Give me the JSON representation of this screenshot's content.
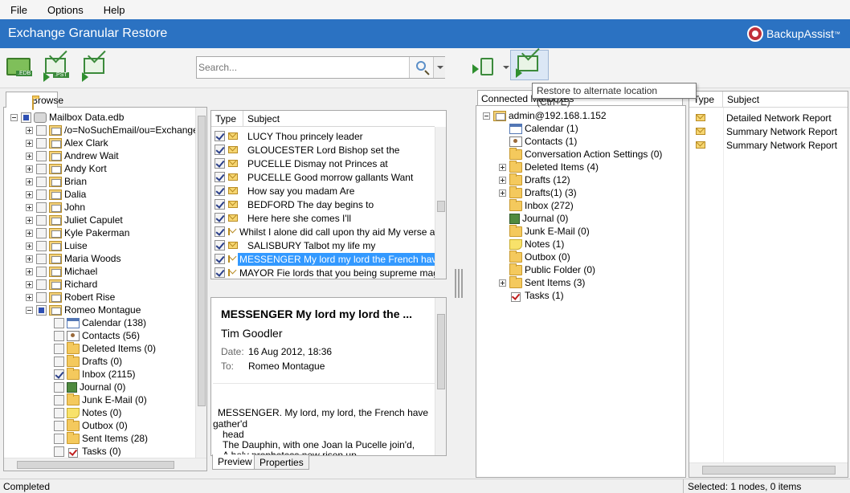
{
  "menu": {
    "file": "File",
    "options": "Options",
    "help": "Help"
  },
  "app_title": "Exchange Granular Restore",
  "brand": "BackupAssist",
  "brand_tm": "™",
  "toolbar": {
    "open_edb_tag": ".EDB",
    "export_pst_tag": ".PST",
    "search_placeholder": "Search...",
    "tooltip": "Restore to alternate location (Ctrl+E)"
  },
  "browse": {
    "tab_label": "Browse",
    "root": "Mailbox Data.edb",
    "mailboxes": [
      "/o=NoSuchEmail/ou=Exchange",
      "Alex Clark",
      "Andrew Wait",
      "Andy Kort",
      "Brian",
      "Dalia",
      "John",
      "Juliet Capulet",
      "Kyle Pakerman",
      "Luise",
      "Maria Woods",
      "Michael",
      "Richard",
      "Robert Rise",
      "Romeo Montague"
    ],
    "romeo_folders": [
      {
        "label": "Calendar (138)",
        "icon": "calendar-icon",
        "checked": false
      },
      {
        "label": "Contacts (56)",
        "icon": "contacts-icon",
        "checked": false
      },
      {
        "label": "Deleted Items (0)",
        "icon": "folder-icon",
        "checked": false
      },
      {
        "label": "Drafts (0)",
        "icon": "folder-icon",
        "checked": false
      },
      {
        "label": "Inbox (2115)",
        "icon": "folder-icon",
        "checked": true
      },
      {
        "label": "Journal (0)",
        "icon": "journal-icon",
        "checked": false
      },
      {
        "label": "Junk E-Mail (0)",
        "icon": "folder-icon",
        "checked": false
      },
      {
        "label": "Notes (0)",
        "icon": "notes-icon",
        "checked": false
      },
      {
        "label": "Outbox (0)",
        "icon": "folder-icon",
        "checked": false
      },
      {
        "label": "Sent Items (28)",
        "icon": "folder-icon",
        "checked": false
      },
      {
        "label": "Tasks (0)",
        "icon": "tasks-icon",
        "checked": false
      }
    ]
  },
  "messages": {
    "col_type": "Type",
    "col_subject": "Subject",
    "rows": [
      "LUCY Thou princely leader",
      "GLOUCESTER Lord Bishop set the",
      "PUCELLE Dismay not Princes at",
      "PUCELLE Good morrow gallants Want",
      "How say you madam Are",
      "BEDFORD The day begins to",
      "Here here she comes I'll",
      "Whilst I alone did call upon thy aid My verse alon",
      "SALISBURY Talbot my life my",
      "MESSENGER My lord my lord the French have g",
      "MAYOR Fie lords that you being supreme magistr"
    ],
    "selected_index": 9
  },
  "preview": {
    "title": "MESSENGER My lord my lord the ...",
    "from": "Tim Goodler",
    "date_label": "Date:",
    "date_value": "16 Aug 2012, 18:36",
    "to_label": "To:",
    "to_value": "Romeo Montague",
    "body_1": "MESSENGER. My lord, my lord, the French have",
    "body_2": "gather'd",
    "body_3": "head",
    "body_4": "The Dauphin, with one Joan la Pucelle join'd,",
    "body_5": "A holy prophetess new risen up",
    "tab_preview": "Preview",
    "tab_properties": "Properties"
  },
  "connected": {
    "tab_label": "Connected Mailboxes",
    "root": "admin@192.168.1.152",
    "items": [
      {
        "label": "Calendar (1)",
        "icon": "calendar-icon",
        "expandable": false
      },
      {
        "label": "Contacts (1)",
        "icon": "contacts-icon",
        "expandable": false
      },
      {
        "label": "Conversation Action Settings (0)",
        "icon": "folder-icon",
        "expandable": false
      },
      {
        "label": "Deleted Items (4)",
        "icon": "folder-icon",
        "expandable": true
      },
      {
        "label": "Drafts (12)",
        "icon": "folder-icon",
        "expandable": true
      },
      {
        "label": "Drafts(1) (3)",
        "icon": "folder-icon",
        "expandable": true
      },
      {
        "label": "Inbox (272)",
        "icon": "folder-icon",
        "expandable": false
      },
      {
        "label": "Journal (0)",
        "icon": "journal-icon",
        "expandable": false
      },
      {
        "label": "Junk E-Mail (0)",
        "icon": "folder-icon",
        "expandable": false
      },
      {
        "label": "Notes (1)",
        "icon": "notes-icon",
        "expandable": false
      },
      {
        "label": "Outbox (0)",
        "icon": "folder-icon",
        "expandable": false
      },
      {
        "label": "Public Folder (0)",
        "icon": "folder-icon",
        "expandable": false
      },
      {
        "label": "Sent Items (3)",
        "icon": "folder-icon",
        "expandable": true
      },
      {
        "label": "Tasks (1)",
        "icon": "tasks-icon",
        "expandable": false
      }
    ]
  },
  "results": {
    "col_type": "Type",
    "col_subject": "Subject",
    "rows": [
      "Detailed Network Report",
      "Summary Network Report",
      "Summary Network Report"
    ]
  },
  "status": {
    "left": "Completed",
    "right": "Selected: 1 nodes, 0 items"
  },
  "colors": {
    "title_band": "#2b72c2",
    "selection": "#3399ff"
  }
}
